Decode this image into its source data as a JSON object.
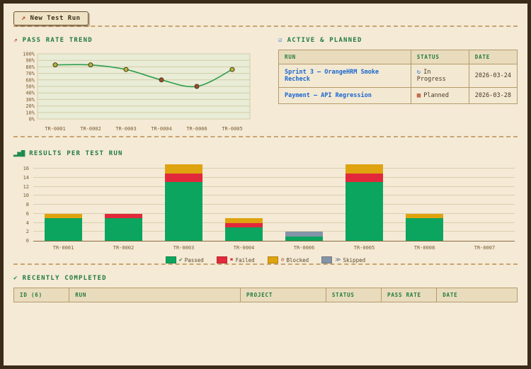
{
  "colors": {
    "accent_green": "#217a3e",
    "link_blue": "#1a66d0",
    "frame_brown": "#3a2c19",
    "background": "#f4ead6"
  },
  "toolbar": {
    "new_run_label": "New Test Run",
    "rocket_glyph": "↗"
  },
  "sections": {
    "trend_icon": "⇗",
    "active_icon": "☑",
    "results_icon": "▂▅▇",
    "completed_icon": "✔"
  },
  "active_planned": {
    "title": "ACTIVE & PLANNED",
    "headers": [
      "RUN",
      "STATUS",
      "DATE"
    ],
    "rows": [
      {
        "run": "Sprint 3 — OrangeHRM Smoke Recheck",
        "status": "In Progress",
        "status_glyph": "↻",
        "date": "2026-03-24"
      },
      {
        "run": "Payment — API Regression",
        "status": "Planned",
        "status_glyph": "▦",
        "date": "2026-03-28"
      }
    ]
  },
  "completed": {
    "title": "RECENTLY COMPLETED",
    "headers": [
      "ID (6)",
      "RUN",
      "PROJECT",
      "STATUS",
      "PASS RATE",
      "DATE"
    ]
  },
  "chart_data": [
    {
      "type": "line",
      "title": "PASS RATE TREND",
      "categories": [
        "TR-0001",
        "TR-0002",
        "TR-0003",
        "TR-0004",
        "TR-0006",
        "TR-0005"
      ],
      "values": [
        83,
        83,
        76,
        60,
        50,
        76
      ],
      "unit": "%",
      "ylim": [
        0,
        100
      ],
      "ytick_step": 10,
      "grid": true,
      "line_color": "#2f9e4f",
      "point_colors": [
        "#b5b43c",
        "#b5b43c",
        "#b5b43c",
        "#a14a2e",
        "#a14a2e",
        "#b5b43c"
      ],
      "plot_bg": "#e9ecd6",
      "grid_color": "#d2cda9"
    },
    {
      "type": "stacked-bar",
      "title": "RESULTS PER TEST RUN",
      "categories": [
        "TR-0001",
        "TR-0002",
        "TR-0003",
        "TR-0004",
        "TR-0006",
        "TR-0005",
        "TR-0008",
        "TR-0007"
      ],
      "series": [
        {
          "name": "Passed",
          "glyph": "✔",
          "glyph_color": "#1c8c4e",
          "color": "#0ba55f",
          "values": [
            5,
            5,
            13,
            3,
            1,
            13,
            5,
            0
          ]
        },
        {
          "name": "Failed",
          "glyph": "✖",
          "glyph_color": "#cc2a2a",
          "color": "#e2293b",
          "values": [
            0,
            1,
            2,
            1,
            0,
            2,
            0,
            0
          ]
        },
        {
          "name": "Blocked",
          "glyph": "⊘",
          "glyph_color": "#b5482a",
          "color": "#dea30f",
          "values": [
            1,
            0,
            2,
            1,
            0,
            2,
            1,
            0
          ]
        },
        {
          "name": "Skipped",
          "glyph": "≫",
          "glyph_color": "#5b7290",
          "color": "#8394a7",
          "values": [
            0,
            0,
            0,
            0,
            1,
            0,
            0,
            0
          ]
        }
      ],
      "ylim": [
        0,
        16
      ],
      "ytick_step": 2,
      "scale_max": 17,
      "legend_position": "bottom"
    }
  ]
}
